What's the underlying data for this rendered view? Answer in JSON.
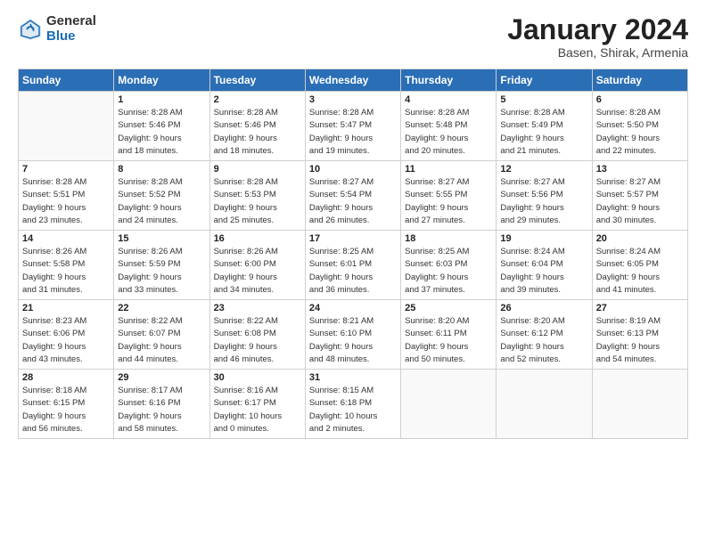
{
  "header": {
    "logo_general": "General",
    "logo_blue": "Blue",
    "month_title": "January 2024",
    "location": "Basen, Shirak, Armenia"
  },
  "days_of_week": [
    "Sunday",
    "Monday",
    "Tuesday",
    "Wednesday",
    "Thursday",
    "Friday",
    "Saturday"
  ],
  "weeks": [
    [
      {
        "day": "",
        "info": ""
      },
      {
        "day": "1",
        "info": "Sunrise: 8:28 AM\nSunset: 5:46 PM\nDaylight: 9 hours\nand 18 minutes."
      },
      {
        "day": "2",
        "info": "Sunrise: 8:28 AM\nSunset: 5:46 PM\nDaylight: 9 hours\nand 18 minutes."
      },
      {
        "day": "3",
        "info": "Sunrise: 8:28 AM\nSunset: 5:47 PM\nDaylight: 9 hours\nand 19 minutes."
      },
      {
        "day": "4",
        "info": "Sunrise: 8:28 AM\nSunset: 5:48 PM\nDaylight: 9 hours\nand 20 minutes."
      },
      {
        "day": "5",
        "info": "Sunrise: 8:28 AM\nSunset: 5:49 PM\nDaylight: 9 hours\nand 21 minutes."
      },
      {
        "day": "6",
        "info": "Sunrise: 8:28 AM\nSunset: 5:50 PM\nDaylight: 9 hours\nand 22 minutes."
      }
    ],
    [
      {
        "day": "7",
        "info": "Sunrise: 8:28 AM\nSunset: 5:51 PM\nDaylight: 9 hours\nand 23 minutes."
      },
      {
        "day": "8",
        "info": "Sunrise: 8:28 AM\nSunset: 5:52 PM\nDaylight: 9 hours\nand 24 minutes."
      },
      {
        "day": "9",
        "info": "Sunrise: 8:28 AM\nSunset: 5:53 PM\nDaylight: 9 hours\nand 25 minutes."
      },
      {
        "day": "10",
        "info": "Sunrise: 8:27 AM\nSunset: 5:54 PM\nDaylight: 9 hours\nand 26 minutes."
      },
      {
        "day": "11",
        "info": "Sunrise: 8:27 AM\nSunset: 5:55 PM\nDaylight: 9 hours\nand 27 minutes."
      },
      {
        "day": "12",
        "info": "Sunrise: 8:27 AM\nSunset: 5:56 PM\nDaylight: 9 hours\nand 29 minutes."
      },
      {
        "day": "13",
        "info": "Sunrise: 8:27 AM\nSunset: 5:57 PM\nDaylight: 9 hours\nand 30 minutes."
      }
    ],
    [
      {
        "day": "14",
        "info": "Sunrise: 8:26 AM\nSunset: 5:58 PM\nDaylight: 9 hours\nand 31 minutes."
      },
      {
        "day": "15",
        "info": "Sunrise: 8:26 AM\nSunset: 5:59 PM\nDaylight: 9 hours\nand 33 minutes."
      },
      {
        "day": "16",
        "info": "Sunrise: 8:26 AM\nSunset: 6:00 PM\nDaylight: 9 hours\nand 34 minutes."
      },
      {
        "day": "17",
        "info": "Sunrise: 8:25 AM\nSunset: 6:01 PM\nDaylight: 9 hours\nand 36 minutes."
      },
      {
        "day": "18",
        "info": "Sunrise: 8:25 AM\nSunset: 6:03 PM\nDaylight: 9 hours\nand 37 minutes."
      },
      {
        "day": "19",
        "info": "Sunrise: 8:24 AM\nSunset: 6:04 PM\nDaylight: 9 hours\nand 39 minutes."
      },
      {
        "day": "20",
        "info": "Sunrise: 8:24 AM\nSunset: 6:05 PM\nDaylight: 9 hours\nand 41 minutes."
      }
    ],
    [
      {
        "day": "21",
        "info": "Sunrise: 8:23 AM\nSunset: 6:06 PM\nDaylight: 9 hours\nand 43 minutes."
      },
      {
        "day": "22",
        "info": "Sunrise: 8:22 AM\nSunset: 6:07 PM\nDaylight: 9 hours\nand 44 minutes."
      },
      {
        "day": "23",
        "info": "Sunrise: 8:22 AM\nSunset: 6:08 PM\nDaylight: 9 hours\nand 46 minutes."
      },
      {
        "day": "24",
        "info": "Sunrise: 8:21 AM\nSunset: 6:10 PM\nDaylight: 9 hours\nand 48 minutes."
      },
      {
        "day": "25",
        "info": "Sunrise: 8:20 AM\nSunset: 6:11 PM\nDaylight: 9 hours\nand 50 minutes."
      },
      {
        "day": "26",
        "info": "Sunrise: 8:20 AM\nSunset: 6:12 PM\nDaylight: 9 hours\nand 52 minutes."
      },
      {
        "day": "27",
        "info": "Sunrise: 8:19 AM\nSunset: 6:13 PM\nDaylight: 9 hours\nand 54 minutes."
      }
    ],
    [
      {
        "day": "28",
        "info": "Sunrise: 8:18 AM\nSunset: 6:15 PM\nDaylight: 9 hours\nand 56 minutes."
      },
      {
        "day": "29",
        "info": "Sunrise: 8:17 AM\nSunset: 6:16 PM\nDaylight: 9 hours\nand 58 minutes."
      },
      {
        "day": "30",
        "info": "Sunrise: 8:16 AM\nSunset: 6:17 PM\nDaylight: 10 hours\nand 0 minutes."
      },
      {
        "day": "31",
        "info": "Sunrise: 8:15 AM\nSunset: 6:18 PM\nDaylight: 10 hours\nand 2 minutes."
      },
      {
        "day": "",
        "info": ""
      },
      {
        "day": "",
        "info": ""
      },
      {
        "day": "",
        "info": ""
      }
    ]
  ]
}
